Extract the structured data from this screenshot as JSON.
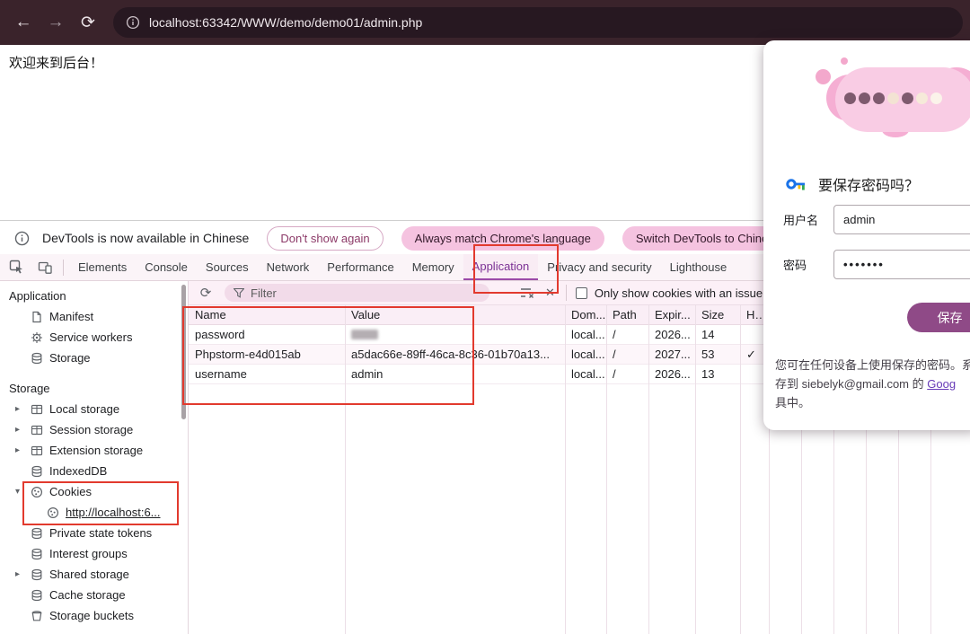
{
  "colors": {
    "topbar_bg": "#3a232b",
    "url_pill_bg": "#271821",
    "accent_pink": "#f5c3e0",
    "selected_tab": "#7b3094",
    "save_button_bg": "#8f4a87",
    "annotation_red": "#e23a2e"
  },
  "browser": {
    "url": "localhost:63342/WWW/demo/demo01/admin.php"
  },
  "page": {
    "welcome_text": "欢迎来到后台！"
  },
  "infobar": {
    "message": "DevTools is now available in Chinese",
    "dismiss_label": "Don't show again",
    "match_label": "Always match Chrome's language",
    "switch_label": "Switch DevTools to Chines"
  },
  "devtools": {
    "tabs": [
      "Elements",
      "Console",
      "Sources",
      "Network",
      "Performance",
      "Memory",
      "Application",
      "Privacy and security",
      "Lighthouse"
    ],
    "selected_tab": "Application",
    "sidebar": {
      "app_header": "Application",
      "app_items": [
        "Manifest",
        "Service workers",
        "Storage"
      ],
      "storage_header": "Storage",
      "storage_items": [
        "Local storage",
        "Session storage",
        "Extension storage",
        "IndexedDB",
        "Cookies",
        "http://localhost:6...",
        "Private state tokens",
        "Interest groups",
        "Shared storage",
        "Cache storage",
        "Storage buckets"
      ]
    },
    "toolbar": {
      "filter_label": "Filter",
      "issue_checkbox_label": "Only show cookies with an issue"
    },
    "cookies_table": {
      "columns": [
        "Name",
        "Value",
        "Dom...",
        "Path",
        "Expir...",
        "Size",
        "Htt..."
      ],
      "rows": [
        {
          "name": "password",
          "value": "",
          "value_redacted": true,
          "domain": "local...",
          "path": "/",
          "expires": "2026...",
          "size": "14",
          "httponly": ""
        },
        {
          "name": "Phpstorm-e4d015ab",
          "value": "a5dac66e-89ff-46ca-8c36-01b70a13...",
          "value_redacted": false,
          "domain": "local...",
          "path": "/",
          "expires": "2027...",
          "size": "53",
          "httponly": "✓"
        },
        {
          "name": "username",
          "value": "admin",
          "value_redacted": false,
          "domain": "local...",
          "path": "/",
          "expires": "2026...",
          "size": "13",
          "httponly": ""
        }
      ]
    }
  },
  "save_password_dialog": {
    "title": "要保存密码吗？",
    "username_label": "用户名",
    "username_value": "admin",
    "password_label": "密码",
    "password_value": "•••••••",
    "save_label": "保存",
    "footer_line1": "您可在任何设备上使用保存的密码。系",
    "footer_line2": "存到 siebelyk@gmail.com 的 ",
    "footer_link": "Goog",
    "footer_line3": "具中。"
  }
}
